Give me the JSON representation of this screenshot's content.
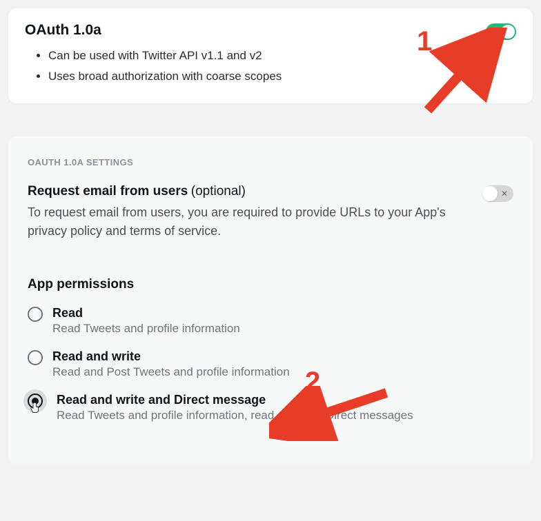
{
  "oauth_card": {
    "title": "OAuth 1.0a",
    "bullets": [
      "Can be used with Twitter API v1.1 and v2",
      "Uses broad authorization with coarse scopes"
    ],
    "toggle_on": true
  },
  "settings": {
    "section_label": "OAUTH 1.0A SETTINGS",
    "request_email": {
      "title": "Request email from users",
      "optional": "(optional)",
      "desc": "To request email from users, you are required to provide URLs to your App's privacy policy and terms of service.",
      "toggle_on": false
    },
    "permissions": {
      "title": "App permissions",
      "options": [
        {
          "label": "Read",
          "desc": "Read Tweets and profile information",
          "selected": false
        },
        {
          "label": "Read and write",
          "desc": "Read and Post Tweets and profile information",
          "selected": false
        },
        {
          "label": "Read and write and Direct message",
          "desc": "Read Tweets and profile information, read and post Direct messages",
          "selected": true
        }
      ]
    }
  },
  "annotations": {
    "one": "1",
    "two": "2"
  },
  "colors": {
    "annotation": "#e73d28",
    "toggle_on": "#25b877"
  }
}
